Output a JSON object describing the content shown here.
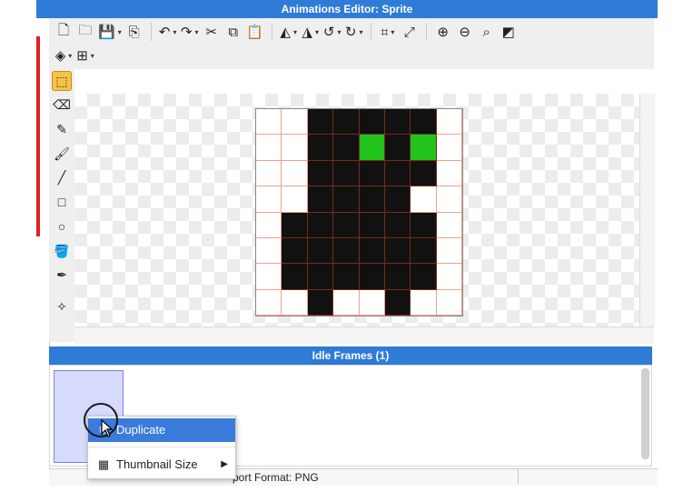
{
  "window": {
    "title": "Animations Editor: Sprite"
  },
  "toolbar": {
    "row1": [
      {
        "name": "new-file-icon",
        "glyph": "🗋"
      },
      {
        "name": "open-folder-icon",
        "glyph": "🗀"
      },
      {
        "name": "save-icon",
        "glyph": "💾",
        "drop": "▾"
      },
      {
        "name": "export-icon",
        "glyph": "⎘"
      },
      {
        "sep": true
      },
      {
        "name": "undo-icon",
        "glyph": "↶",
        "drop": "▾"
      },
      {
        "name": "redo-icon",
        "glyph": "↷",
        "drop": "▾"
      },
      {
        "name": "cut-icon",
        "glyph": "✂"
      },
      {
        "name": "copy-icon",
        "glyph": "⧉"
      },
      {
        "name": "paste-icon",
        "glyph": "📋"
      },
      {
        "sep": true
      },
      {
        "name": "flip-horizontal-icon",
        "glyph": "◭",
        "drop": "▾"
      },
      {
        "name": "flip-vertical-icon",
        "glyph": "◮",
        "drop": "▾"
      },
      {
        "name": "rotate-left-icon",
        "glyph": "↺",
        "drop": "▾"
      },
      {
        "name": "rotate-right-icon",
        "glyph": "↻",
        "drop": "▾"
      },
      {
        "sep": true
      },
      {
        "name": "crop-icon",
        "glyph": "⌗",
        "drop": "▾"
      },
      {
        "name": "resize-icon",
        "glyph": "⤢"
      },
      {
        "sep": true
      },
      {
        "name": "zoom-in-icon",
        "glyph": "⊕"
      },
      {
        "name": "zoom-out-icon",
        "glyph": "⊖"
      },
      {
        "name": "zoom-fit-icon",
        "glyph": "⌕"
      },
      {
        "name": "invert-colors-icon",
        "glyph": "◩"
      }
    ],
    "row2": [
      {
        "name": "layers-icon",
        "glyph": "◈",
        "drop": "▾"
      },
      {
        "name": "grid-icon",
        "glyph": "⊞",
        "drop": "▾"
      }
    ]
  },
  "tools": [
    {
      "name": "selection-tool-icon",
      "glyph": "⬚",
      "active": true
    },
    {
      "name": "eraser-tool-icon",
      "glyph": "⌫"
    },
    {
      "name": "pencil-tool-icon",
      "glyph": "✎"
    },
    {
      "name": "brush-tool-icon",
      "glyph": "🖌"
    },
    {
      "name": "line-tool-icon",
      "glyph": "╱"
    },
    {
      "name": "rectangle-tool-icon",
      "glyph": "□"
    },
    {
      "name": "ellipse-tool-icon",
      "glyph": "○"
    },
    {
      "name": "fill-bucket-tool-icon",
      "glyph": "🪣"
    },
    {
      "name": "eyedropper-tool-icon",
      "glyph": "✒"
    },
    {
      "name": "center-tool-icon",
      "glyph": "✧"
    }
  ],
  "sprite": {
    "palette": {
      "0": "#ffffff",
      "1": "#111111",
      "2": "#22c41c"
    },
    "pixels": [
      [
        0,
        0,
        1,
        1,
        1,
        1,
        1,
        0
      ],
      [
        0,
        0,
        1,
        1,
        2,
        1,
        2,
        0
      ],
      [
        0,
        0,
        1,
        1,
        1,
        1,
        1,
        0
      ],
      [
        0,
        0,
        1,
        1,
        1,
        1,
        0,
        0
      ],
      [
        0,
        1,
        1,
        1,
        1,
        1,
        1,
        0
      ],
      [
        0,
        1,
        1,
        1,
        1,
        1,
        1,
        0
      ],
      [
        0,
        1,
        1,
        1,
        1,
        1,
        1,
        0
      ],
      [
        0,
        0,
        1,
        0,
        0,
        1,
        0,
        0
      ]
    ]
  },
  "frames": {
    "header": "Idle Frames (1)"
  },
  "context_menu": {
    "items": [
      {
        "label": "Duplicate",
        "icon": "duplicate-icon",
        "glyph": "⧉",
        "highlighted": true
      },
      {
        "label": "Thumbnail Size",
        "icon": "thumbnail-grid-icon",
        "glyph": "▦",
        "arrow": "▶"
      }
    ]
  },
  "status": {
    "export_format": "port Format: PNG"
  },
  "colors": {
    "accent": "#2f7bd8",
    "selection": "#3b7bdc",
    "active_tool": "#f6c24a",
    "pixel_green": "#22c41c"
  }
}
